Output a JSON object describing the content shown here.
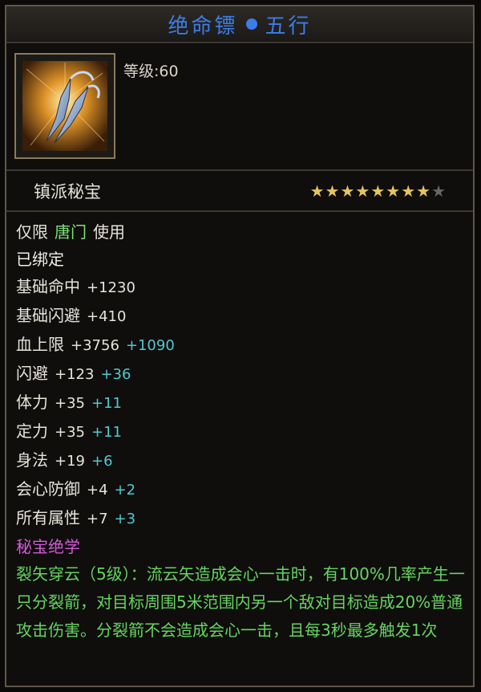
{
  "title": {
    "name": "绝命镖",
    "series": "五行"
  },
  "item": {
    "icon": "throwing-dart-icon",
    "level_text": "等级:60",
    "rarity": "镇派秘宝",
    "stars_total": 9,
    "stars_filled": 8
  },
  "restriction": {
    "prefix": "仅限",
    "sect": "唐门",
    "suffix": "使用"
  },
  "bound": "已绑定",
  "stats": [
    {
      "name": "基础命中",
      "base": "+1230",
      "bonus": ""
    },
    {
      "name": "基础闪避",
      "base": "+410",
      "bonus": ""
    },
    {
      "name": "血上限",
      "base": "+3756",
      "bonus": "+1090"
    },
    {
      "name": "闪避",
      "base": "+123",
      "bonus": "+36"
    },
    {
      "name": "体力",
      "base": "+35",
      "bonus": "+11"
    },
    {
      "name": "定力",
      "base": "+35",
      "bonus": "+11"
    },
    {
      "name": "身法",
      "base": "+19",
      "bonus": "+6"
    },
    {
      "name": "会心防御",
      "base": "+4",
      "bonus": "+2"
    },
    {
      "name": "所有属性",
      "base": "+7",
      "bonus": "+3"
    }
  ],
  "skill": {
    "header": "秘宝绝学",
    "desc": "裂矢穿云（5级）：流云矢造成会心一击时，有100%几率产生一只分裂箭，对目标周围5米范围内另一个敌对目标造成20%普通攻击伤害。分裂箭不会造成会心一击，且每3秒最多触发1次"
  },
  "colors": {
    "title": "#3c7de8",
    "sect": "#7fe07a",
    "bonus": "#52c8cf",
    "skill_header": "#d45ad8",
    "skill_desc": "#66d460",
    "star": "#e8c45a"
  }
}
